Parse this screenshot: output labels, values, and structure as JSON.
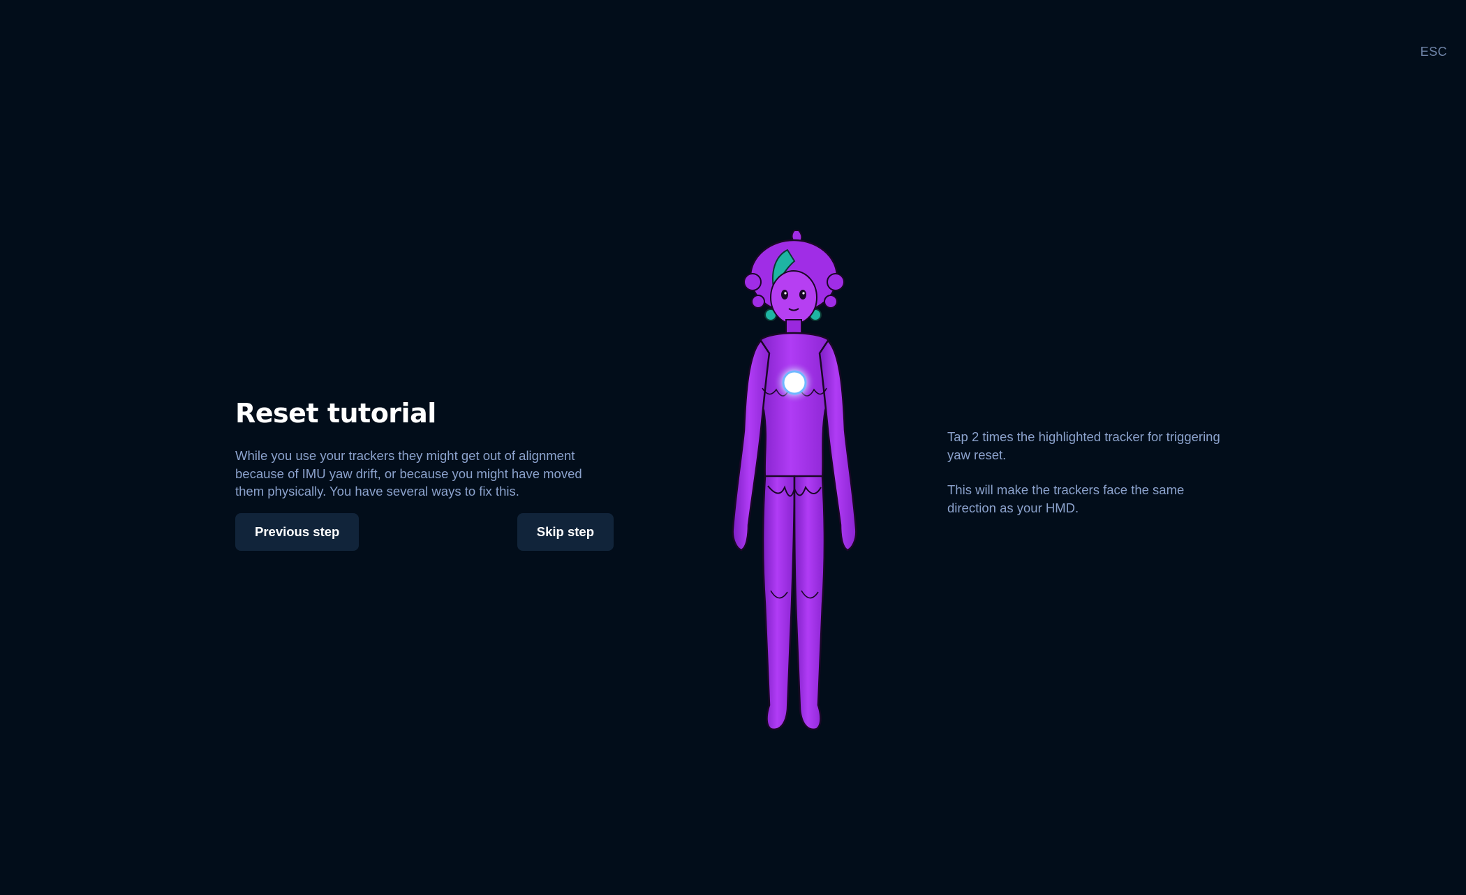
{
  "header": {
    "esc_label": "ESC"
  },
  "tutorial": {
    "title": "Reset tutorial",
    "description": "While you use your trackers they might get out of alignment because of IMU yaw drift, or because you might have moved them physically. You have several ways to fix this.",
    "previous_label": "Previous step",
    "skip_label": "Skip step"
  },
  "instructions": {
    "line1": "Tap 2 times the highlighted tracker for triggering yaw reset.",
    "line2": "This will make the trackers face the same direction as your HMD."
  },
  "figure": {
    "icon": "avatar-body-icon",
    "tracker_icon": "tracker-highlight-icon",
    "body_color": "#a02de6",
    "hair_accent_color": "#1fb5a3",
    "tracker_color": "#ffffff"
  },
  "colors": {
    "background": "#020d1a",
    "button_bg": "#11243a",
    "text_muted": "#8ba2cc",
    "title": "#ffffff"
  }
}
